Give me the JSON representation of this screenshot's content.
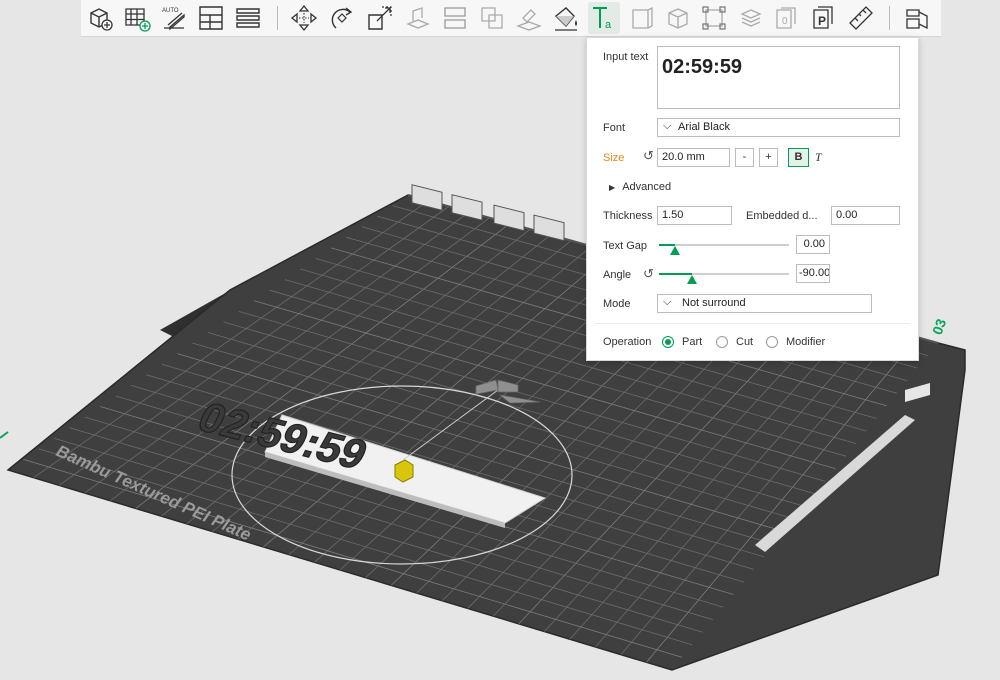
{
  "toolbar": {
    "tools": [
      "add-object-icon",
      "add-plate-icon",
      "auto-orient-icon",
      "arrange-icon",
      "split-list-icon",
      "move-icon",
      "rotate-icon",
      "scale-icon",
      "place-on-face-icon",
      "cut-icon",
      "boolean-icon",
      "support-paint-icon",
      "color-paint-icon",
      "text-icon",
      "emboss-icon",
      "mesh-boolean-icon",
      "simplify-icon",
      "layers-icon",
      "variable-layer-icon",
      "measure-icon",
      "assembly-icon"
    ],
    "auto_label": "AUTO"
  },
  "scene": {
    "plate_label": "Bambu Textured PEI Plate",
    "plate_number": "03",
    "model_text": "02:59:59"
  },
  "panel": {
    "input_text_label": "Input text",
    "input_text_value": "02:59:59",
    "font_label": "Font",
    "font_value": "Arial Black",
    "size_label": "Size",
    "size_value": "20.0 mm",
    "size_minus": "-",
    "size_plus": "+",
    "bold_label": "B",
    "italic_label": "T",
    "advanced_label": "Advanced",
    "thickness_label": "Thickness",
    "thickness_value": "1.50",
    "embedded_label": "Embedded d...",
    "embedded_value": "0.00",
    "text_gap_label": "Text Gap",
    "text_gap_value": "0.00",
    "text_gap_fraction": 0.12,
    "angle_label": "Angle",
    "angle_value": "-90.00",
    "angle_fraction": 0.25,
    "mode_label": "Mode",
    "mode_value": "Not surround",
    "operation_label": "Operation",
    "operations": [
      "Part",
      "Cut",
      "Modifier"
    ],
    "operation_selected": "Part"
  },
  "colors": {
    "accent": "#009d53",
    "size_label": "#e08a16",
    "plate": "#3f3f3f",
    "grid": "#6b6b6b"
  }
}
